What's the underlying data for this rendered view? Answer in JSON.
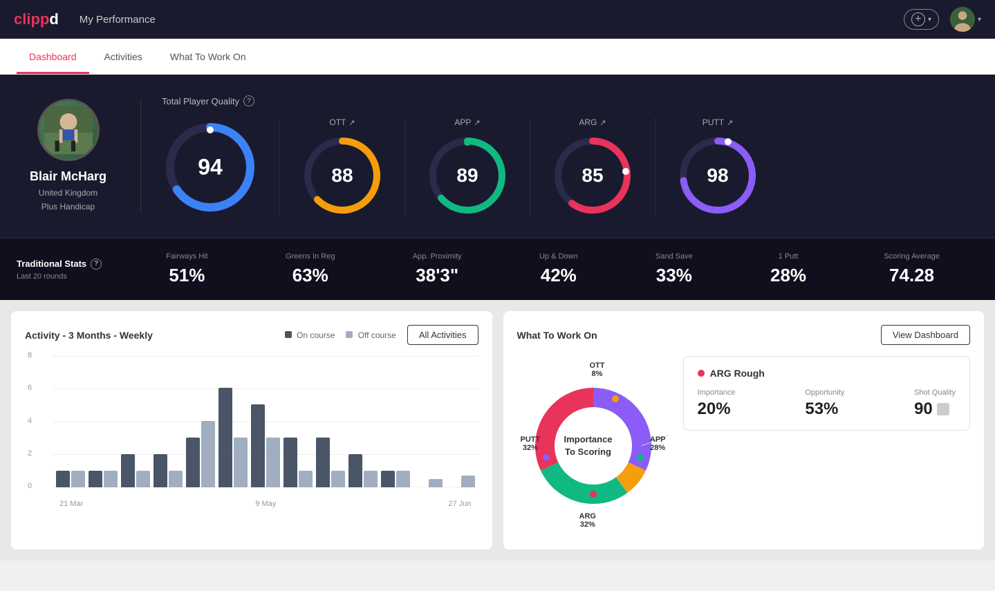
{
  "app": {
    "logo": "clippd",
    "nav_title": "My Performance"
  },
  "tabs": [
    {
      "id": "dashboard",
      "label": "Dashboard",
      "active": true
    },
    {
      "id": "activities",
      "label": "Activities",
      "active": false
    },
    {
      "id": "what-to-work-on",
      "label": "What To Work On",
      "active": false
    }
  ],
  "hero": {
    "player": {
      "name": "Blair McHarg",
      "country": "United Kingdom",
      "handicap": "Plus Handicap"
    },
    "total_player_quality": {
      "label": "Total Player Quality",
      "value": 94,
      "color": "#3b82f6"
    },
    "metrics": [
      {
        "id": "ott",
        "label": "OTT",
        "value": 88,
        "color": "#f59e0b",
        "pct": 88
      },
      {
        "id": "app",
        "label": "APP",
        "value": 89,
        "color": "#10b981",
        "pct": 89
      },
      {
        "id": "arg",
        "label": "ARG",
        "value": 85,
        "color": "#e8335a",
        "pct": 85
      },
      {
        "id": "putt",
        "label": "PUTT",
        "value": 98,
        "color": "#8b5cf6",
        "pct": 98
      }
    ]
  },
  "traditional_stats": {
    "title": "Traditional Stats",
    "period": "Last 20 rounds",
    "stats": [
      {
        "name": "Fairways Hit",
        "value": "51%"
      },
      {
        "name": "Greens In Reg",
        "value": "63%"
      },
      {
        "name": "App. Proximity",
        "value": "38'3\""
      },
      {
        "name": "Up & Down",
        "value": "42%"
      },
      {
        "name": "Sand Save",
        "value": "33%"
      },
      {
        "name": "1 Putt",
        "value": "28%"
      },
      {
        "name": "Scoring Average",
        "value": "74.28"
      }
    ]
  },
  "activity_chart": {
    "title": "Activity - 3 Months - Weekly",
    "legend": {
      "on_course": "On course",
      "off_course": "Off course"
    },
    "all_activities_btn": "All Activities",
    "x_labels": [
      "21 Mar",
      "9 May",
      "27 Jun"
    ],
    "y_labels": [
      "0",
      "2",
      "4",
      "6",
      "8"
    ],
    "bars": [
      {
        "on": 1,
        "off": 1
      },
      {
        "on": 1,
        "off": 1
      },
      {
        "on": 2,
        "off": 1
      },
      {
        "on": 2,
        "off": 1
      },
      {
        "on": 3,
        "off": 4
      },
      {
        "on": 6,
        "off": 3
      },
      {
        "on": 5,
        "off": 3
      },
      {
        "on": 3,
        "off": 1
      },
      {
        "on": 3,
        "off": 1
      },
      {
        "on": 2,
        "off": 1
      },
      {
        "on": 1,
        "off": 1
      },
      {
        "on": 0,
        "off": 0.5
      },
      {
        "on": 0,
        "off": 0.7
      }
    ]
  },
  "what_to_work_on": {
    "title": "What To Work On",
    "view_dashboard_btn": "View Dashboard",
    "donut": {
      "center_label": "Importance\nTo Scoring",
      "segments": [
        {
          "label": "OTT",
          "pct": "8%",
          "color": "#f59e0b"
        },
        {
          "label": "APP",
          "pct": "28%",
          "color": "#10b981"
        },
        {
          "label": "ARG",
          "pct": "32%",
          "color": "#e8335a"
        },
        {
          "label": "PUTT",
          "pct": "32%",
          "color": "#8b5cf6"
        }
      ]
    },
    "info_card": {
      "title": "ARG Rough",
      "importance_label": "Importance",
      "importance_val": "20%",
      "opportunity_label": "Opportunity",
      "opportunity_val": "53%",
      "shot_quality_label": "Shot Quality",
      "shot_quality_val": "90"
    }
  }
}
